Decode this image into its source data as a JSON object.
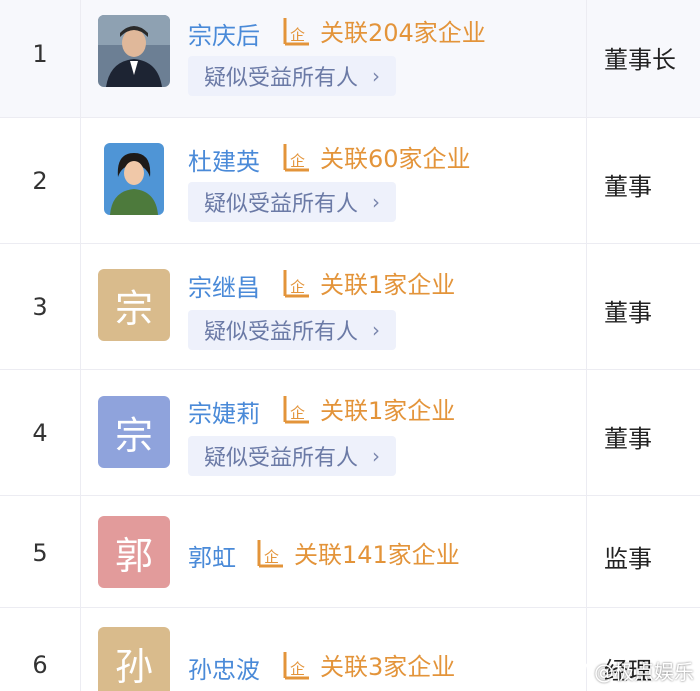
{
  "colors": {
    "name": "#4a8ad8",
    "relation": "#e3943a",
    "tag_bg": "#eef1fb",
    "tag_text": "#6b7aa6"
  },
  "rows": [
    {
      "index": "1",
      "name": "宗庆后",
      "relation": "关联204家企业",
      "tag": "疑似受益所有人",
      "role": "董事长",
      "avatar": {
        "type": "photo"
      }
    },
    {
      "index": "2",
      "name": "杜建英",
      "relation": "关联60家企业",
      "tag": "疑似受益所有人",
      "role": "董事",
      "avatar": {
        "type": "photo"
      }
    },
    {
      "index": "3",
      "name": "宗继昌",
      "relation": "关联1家企业",
      "tag": "疑似受益所有人",
      "role": "董事",
      "avatar": {
        "type": "letter",
        "letter": "宗",
        "color": "#d9bb8c"
      }
    },
    {
      "index": "4",
      "name": "宗婕莉",
      "relation": "关联1家企业",
      "tag": "疑似受益所有人",
      "role": "董事",
      "avatar": {
        "type": "letter",
        "letter": "宗",
        "color": "#8fa3dc"
      }
    },
    {
      "index": "5",
      "name": "郭虹",
      "relation": "关联141家企业",
      "role": "监事",
      "avatar": {
        "type": "letter",
        "letter": "郭",
        "color": "#e29b9b"
      }
    },
    {
      "index": "6",
      "name": "孙忠波",
      "relation": "关联3家企业",
      "role": "经理",
      "avatar": {
        "type": "letter",
        "letter": "孙",
        "color": "#d9bb8c"
      }
    }
  ],
  "tag_chevron": "›",
  "watermark": "@极点娱乐"
}
